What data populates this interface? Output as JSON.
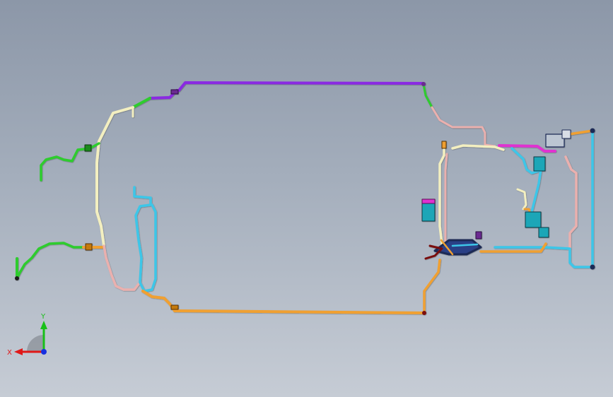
{
  "scene": {
    "description_type": "cad-3d-harness-assembly",
    "background_gradient": [
      "#8c97a8",
      "#c6ccd5"
    ],
    "wire_colors": {
      "purple": "#8a2be2",
      "magenta": "#e030d0",
      "green": "#2ecc2e",
      "cream": "#f3efc0",
      "pink": "#eab0ae",
      "orange": "#f0a030",
      "light_blue": "#3ec6e8",
      "dark_navy": "#1d2a55",
      "dark_red": "#7a1010"
    }
  },
  "triad": {
    "x_label": "X",
    "y_label": "Y",
    "x_color": "#e01818",
    "y_color": "#18c018",
    "z_color": "#1830e0"
  }
}
